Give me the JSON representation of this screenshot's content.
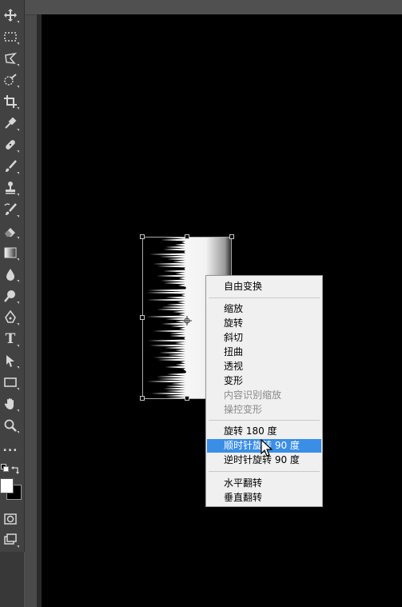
{
  "colors": {
    "foreground": "#ffffff",
    "background": "#000000",
    "menu_highlight": "#3a8ee6",
    "canvas": "#000000"
  },
  "toolbar": {
    "tools": [
      {
        "name": "move-tool-icon"
      },
      {
        "name": "marquee-tool-icon"
      },
      {
        "name": "lasso-tool-icon"
      },
      {
        "name": "quick-selection-tool-icon"
      },
      {
        "name": "crop-tool-icon"
      },
      {
        "name": "eyedropper-tool-icon"
      },
      {
        "name": "healing-brush-tool-icon"
      },
      {
        "name": "brush-tool-icon"
      },
      {
        "name": "clone-stamp-tool-icon"
      },
      {
        "name": "history-brush-tool-icon"
      },
      {
        "name": "eraser-tool-icon"
      },
      {
        "name": "gradient-tool-icon"
      },
      {
        "name": "blur-tool-icon"
      },
      {
        "name": "dodge-tool-icon"
      },
      {
        "name": "pen-tool-icon"
      },
      {
        "name": "type-tool-icon"
      },
      {
        "name": "path-selection-tool-icon"
      },
      {
        "name": "rectangle-tool-icon"
      },
      {
        "name": "hand-tool-icon"
      },
      {
        "name": "zoom-tool-icon"
      },
      {
        "name": "more-tools-icon"
      }
    ],
    "type_tool_label": "T",
    "more_tools_label": "..."
  },
  "context_menu": {
    "items": [
      {
        "label": "自由变换",
        "enabled": true
      },
      {
        "label": "缩放",
        "enabled": true
      },
      {
        "label": "旋转",
        "enabled": true
      },
      {
        "label": "斜切",
        "enabled": true
      },
      {
        "label": "扭曲",
        "enabled": true
      },
      {
        "label": "透视",
        "enabled": true
      },
      {
        "label": "变形",
        "enabled": true
      },
      {
        "label": "内容识别缩放",
        "enabled": false
      },
      {
        "label": "操控变形",
        "enabled": false
      },
      {
        "label": "旋转 180 度",
        "enabled": true
      },
      {
        "label": "顺时针旋转 90 度",
        "enabled": true,
        "highlighted": true
      },
      {
        "label": "逆时针旋转 90 度",
        "enabled": true
      },
      {
        "label": "水平翻转",
        "enabled": true
      },
      {
        "label": "垂直翻转",
        "enabled": true
      }
    ]
  }
}
